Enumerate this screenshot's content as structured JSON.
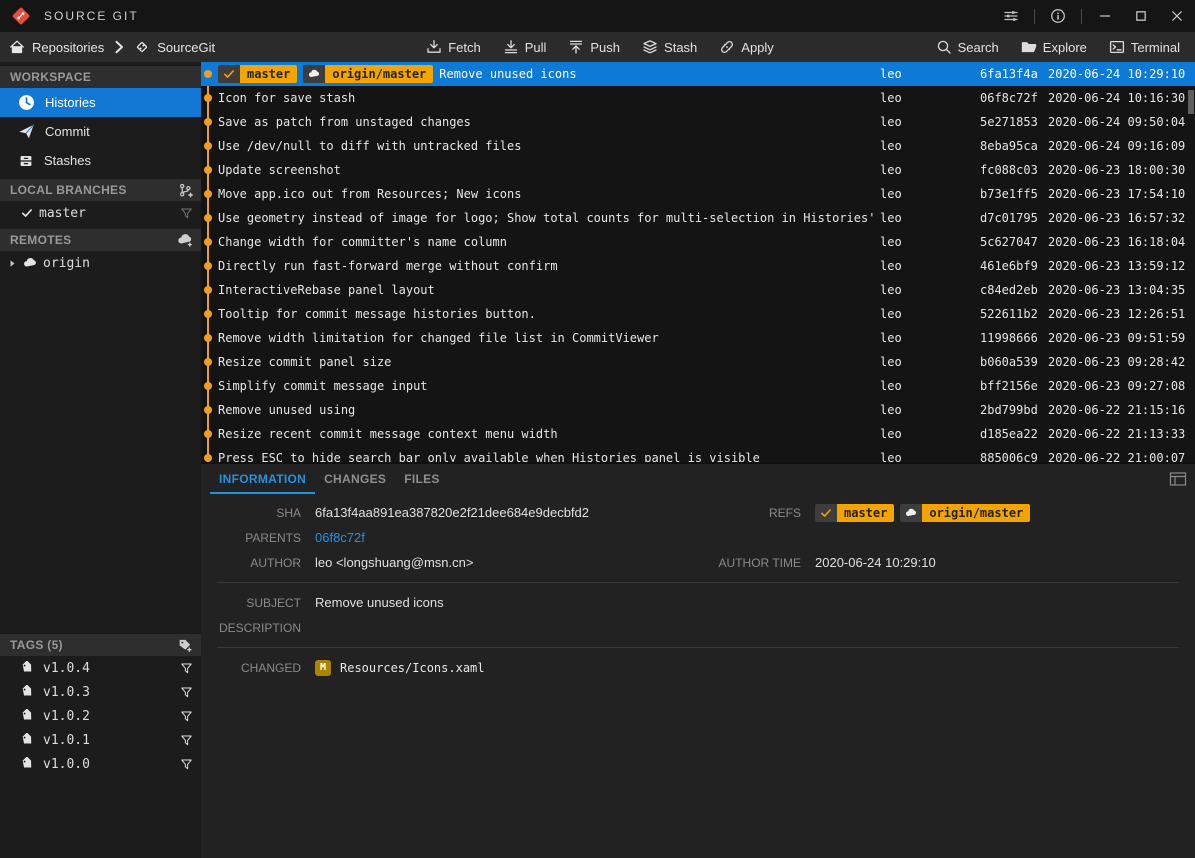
{
  "window": {
    "title": "SOURCE GIT"
  },
  "toolbar": {
    "breadcrumb_root": "Repositories",
    "breadcrumb_repo": "SourceGit",
    "fetch": "Fetch",
    "pull": "Pull",
    "push": "Push",
    "stash": "Stash",
    "apply": "Apply",
    "search": "Search",
    "explore": "Explore",
    "terminal": "Terminal"
  },
  "sidebar": {
    "workspace_header": "WORKSPACE",
    "workspace_items": [
      {
        "label": "Histories",
        "icon": "clock-icon",
        "active": true
      },
      {
        "label": "Commit",
        "icon": "send-icon",
        "active": false
      },
      {
        "label": "Stashes",
        "icon": "archive-icon",
        "active": false
      }
    ],
    "local_branches_header": "LOCAL BRANCHES",
    "branches": [
      {
        "label": "master",
        "current": true
      }
    ],
    "remotes_header": "REMOTES",
    "remotes": [
      {
        "label": "origin"
      }
    ],
    "tags_header": "TAGS (5)",
    "tags": [
      "v1.0.4",
      "v1.0.3",
      "v1.0.2",
      "v1.0.1",
      "v1.0.0"
    ]
  },
  "history_rows": [
    {
      "selected": true,
      "refs": [
        {
          "type": "local",
          "label": "master"
        },
        {
          "type": "remote",
          "label": "origin/master"
        }
      ],
      "subject": "Remove unused icons",
      "author": "leo",
      "sha": "6fa13f4a",
      "time": "2020-06-24 10:29:10"
    },
    {
      "subject": "Icon for save stash",
      "author": "leo",
      "sha": "06f8c72f",
      "time": "2020-06-24 10:16:30"
    },
    {
      "subject": "Save as patch from unstaged changes",
      "author": "leo",
      "sha": "5e271853",
      "time": "2020-06-24 09:50:04"
    },
    {
      "subject": "Use /dev/null to diff with untracked files",
      "author": "leo",
      "sha": "8eba95ca",
      "time": "2020-06-24 09:16:09"
    },
    {
      "subject": "Update screenshot",
      "author": "leo",
      "sha": "fc088c03",
      "time": "2020-06-23 18:00:30"
    },
    {
      "subject": "Move app.ico out from Resources; New icons",
      "author": "leo",
      "sha": "b73e1ff5",
      "time": "2020-06-23 17:54:10"
    },
    {
      "subject": "Use geometry instead of image for logo; Show total counts for multi-selection in Histories' DataGrid",
      "author": "leo",
      "sha": "d7c01795",
      "time": "2020-06-23 16:57:32"
    },
    {
      "subject": "Change width for committer's name column",
      "author": "leo",
      "sha": "5c627047",
      "time": "2020-06-23 16:18:04"
    },
    {
      "subject": "Directly run fast-forward merge without confirm",
      "author": "leo",
      "sha": "461e6bf9",
      "time": "2020-06-23 13:59:12"
    },
    {
      "subject": "InteractiveRebase panel layout",
      "author": "leo",
      "sha": "c84ed2eb",
      "time": "2020-06-23 13:04:35"
    },
    {
      "subject": "Tooltip for commit message histories button.",
      "author": "leo",
      "sha": "522611b2",
      "time": "2020-06-23 12:26:51"
    },
    {
      "subject": "Remove width limitation for changed file list in CommitViewer",
      "author": "leo",
      "sha": "11998666",
      "time": "2020-06-23 09:51:59"
    },
    {
      "subject": "Resize commit panel size",
      "author": "leo",
      "sha": "b060a539",
      "time": "2020-06-23 09:28:42"
    },
    {
      "subject": "Simplify commit message input",
      "author": "leo",
      "sha": "bff2156e",
      "time": "2020-06-23 09:27:08"
    },
    {
      "subject": "Remove unused using",
      "author": "leo",
      "sha": "2bd799bd",
      "time": "2020-06-22 21:15:16"
    },
    {
      "subject": "Resize recent commit message context menu width",
      "author": "leo",
      "sha": "d185ea22",
      "time": "2020-06-22 21:13:33"
    },
    {
      "subject": "Press ESC to hide search bar only available when Histories panel is visible",
      "author": "leo",
      "sha": "885006c9",
      "time": "2020-06-22 21:00:07"
    }
  ],
  "detail": {
    "tabs": [
      "INFORMATION",
      "CHANGES",
      "FILES"
    ],
    "active_tab": "INFORMATION",
    "sha_label": "SHA",
    "sha": "6fa13f4aa891ea387820e2f21dee684e9decbfd2",
    "refs_label": "REFS",
    "refs": [
      {
        "type": "local",
        "label": "master"
      },
      {
        "type": "remote",
        "label": "origin/master"
      }
    ],
    "parents_label": "PARENTS",
    "parents": [
      "06f8c72f"
    ],
    "author_label": "AUTHOR",
    "author": "leo <longshuang@msn.cn>",
    "author_time_label": "AUTHOR TIME",
    "author_time": "2020-06-24 10:29:10",
    "subject_label": "SUBJECT",
    "subject": "Remove unused icons",
    "description_label": "DESCRIPTION",
    "description": "",
    "changed_label": "CHANGED",
    "changed_files": [
      {
        "status": "M",
        "path": "Resources/Icons.xaml"
      }
    ]
  },
  "colors": {
    "selection_blue": "#0d7ad8",
    "graph_orange": "#ef9d26",
    "badge_orange": "#f4a400",
    "tab_active_blue": "#2493df",
    "link_blue": "#2690e0",
    "modified_badge_gold": "#ab8300"
  }
}
